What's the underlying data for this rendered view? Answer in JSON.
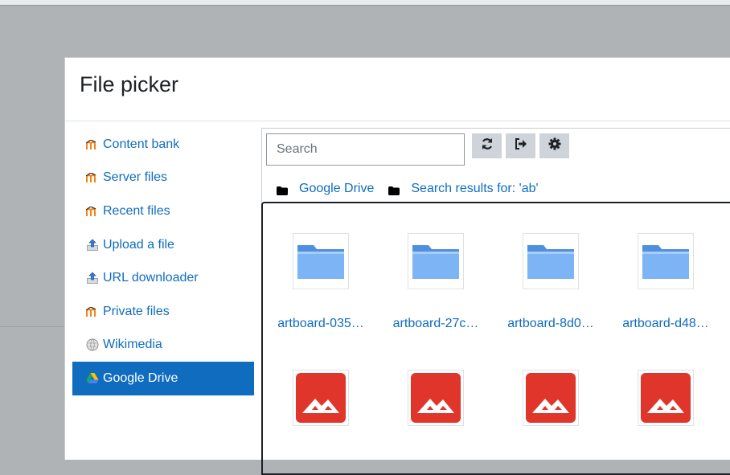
{
  "dialog": {
    "title": "File picker"
  },
  "repositories": [
    {
      "label": "Content bank",
      "icon": "moodle-icon"
    },
    {
      "label": "Server files",
      "icon": "moodle-icon"
    },
    {
      "label": "Recent files",
      "icon": "moodle-icon"
    },
    {
      "label": "Upload a file",
      "icon": "upload-icon"
    },
    {
      "label": "URL downloader",
      "icon": "upload-icon"
    },
    {
      "label": "Private files",
      "icon": "moodle-icon"
    },
    {
      "label": "Wikimedia",
      "icon": "wikimedia-icon"
    },
    {
      "label": "Google Drive",
      "icon": "google-drive-icon",
      "active": true
    }
  ],
  "toolbar": {
    "search_placeholder": "Search",
    "buttons": [
      "refresh-icon",
      "logout-icon",
      "gear-icon"
    ]
  },
  "path": [
    {
      "label": "Google Drive",
      "icon": "folder-icon"
    },
    {
      "label": "Search results for: 'ab'",
      "icon": "folder-icon"
    }
  ],
  "files": [
    {
      "name": "artboard-035…",
      "type": "folder"
    },
    {
      "name": "artboard-27c…",
      "type": "folder"
    },
    {
      "name": "artboard-8d0…",
      "type": "folder"
    },
    {
      "name": "artboard-d48…",
      "type": "folder"
    },
    {
      "name": "",
      "type": "image"
    },
    {
      "name": "",
      "type": "image"
    },
    {
      "name": "",
      "type": "image"
    },
    {
      "name": "",
      "type": "image"
    }
  ],
  "colors": {
    "accent": "#0f6cbf",
    "image_red": "#e0352b",
    "folder_blue": "#6aa6f0"
  }
}
